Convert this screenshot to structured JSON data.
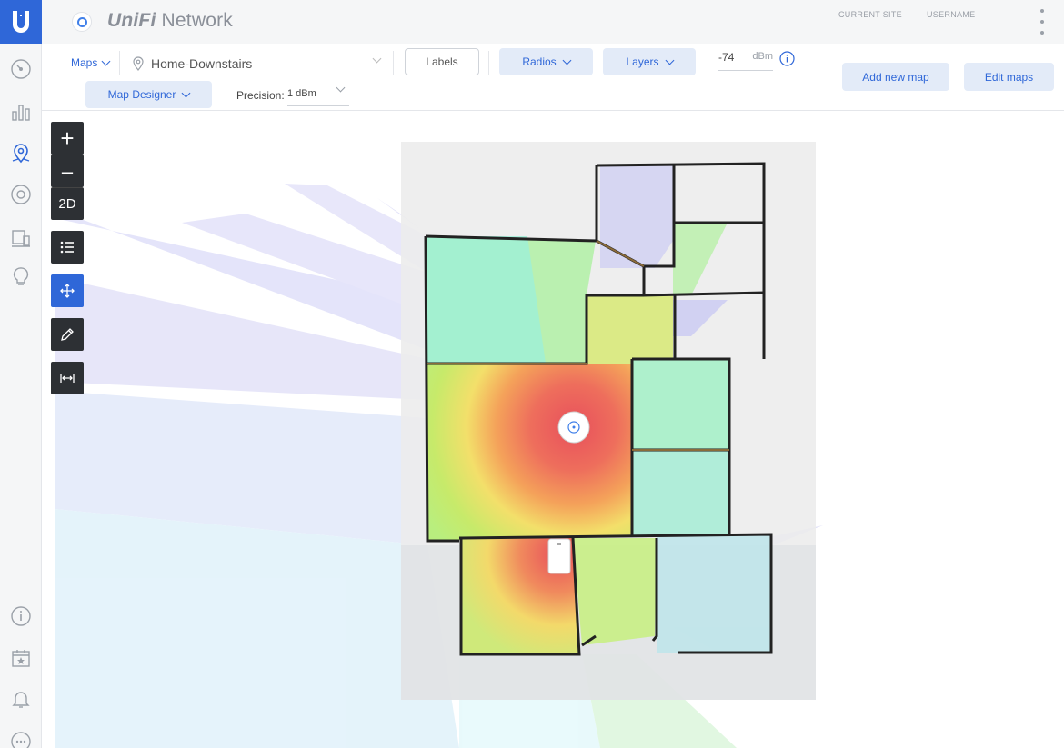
{
  "app": {
    "brand_prefix": "UniFi",
    "brand_suffix": "Network"
  },
  "header": {
    "current_site_label": "CURRENT SITE",
    "username_label": "USERNAME"
  },
  "toolbar": {
    "maps_label": "Maps",
    "map_name": "Home-Downstairs",
    "labels_button": "Labels",
    "radios_button": "Radios",
    "layers_button": "Layers",
    "signal_value": "-74",
    "signal_unit": "dBm",
    "add_map_button": "Add new map",
    "edit_maps_button": "Edit maps",
    "designer_button": "Map Designer",
    "precision_label": "Precision:",
    "precision_value": "1 dBm"
  },
  "tools": {
    "zoom_in": "+",
    "zoom_out": "–",
    "view_mode": "2D"
  },
  "colors": {
    "accent": "#2f67d8",
    "rail_bg": "#f5f6f7",
    "tool_bg": "#2d3034"
  }
}
